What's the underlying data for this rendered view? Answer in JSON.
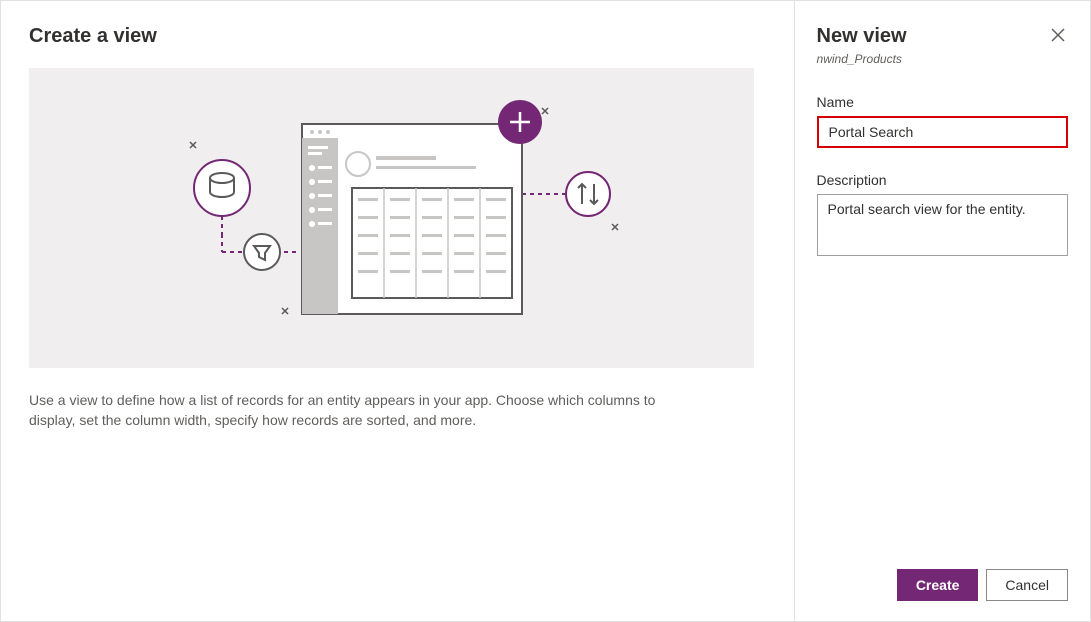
{
  "left": {
    "title": "Create a view",
    "description": "Use a view to define how a list of records for an entity appears in your app. Choose which columns to display, set the column width, specify how records are sorted, and more."
  },
  "right": {
    "title": "New view",
    "entity": "nwind_Products",
    "name_label": "Name",
    "name_value": "Portal Search",
    "desc_label": "Description",
    "desc_value": "Portal search view for the entity."
  },
  "buttons": {
    "create": "Create",
    "cancel": "Cancel"
  }
}
